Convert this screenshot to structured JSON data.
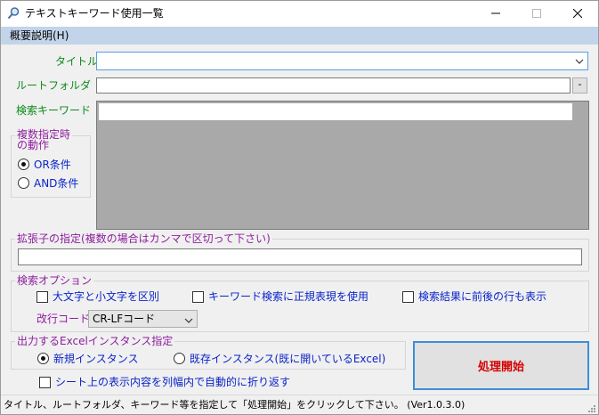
{
  "window": {
    "title": "テキストキーワード使用一覧",
    "icons": {
      "app": "search-icon",
      "minimize": "minimize-icon",
      "maximize": "maximize-icon",
      "close": "close-icon"
    }
  },
  "menu": {
    "overview": "概要説明(H)"
  },
  "form": {
    "title_label": "タイトル",
    "title_value": "",
    "folder_label": "ルートフォルダ",
    "folder_value": "",
    "folder_button": "-",
    "keyword_label": "検索キーワード"
  },
  "multi_group": {
    "caption": "複数指定時\nの動作",
    "options": [
      {
        "label": "OR条件",
        "checked": true
      },
      {
        "label": "AND条件",
        "checked": false
      }
    ]
  },
  "ext_group": {
    "caption": "拡張子の指定(複数の場合はカンマで区切って下さい)",
    "value": ""
  },
  "search_options": {
    "caption": "検索オプション",
    "checks": [
      {
        "label": "大文字と小文字を区別",
        "checked": false
      },
      {
        "label": "キーワード検索に正規表現を使用",
        "checked": false
      },
      {
        "label": "検索結果に前後の行も表示",
        "checked": false
      }
    ],
    "newline_label": "改行コード",
    "newline_value": "CR-LFコード"
  },
  "excel_group": {
    "caption": "出力するExcelインスタンス指定",
    "options": [
      {
        "label": "新規インスタンス",
        "checked": true
      },
      {
        "label": "既存インスタンス(既に開いているExcel)",
        "checked": false
      }
    ]
  },
  "wrap_check": {
    "label": "シート上の表示内容を列幅内で自動的に折り返す",
    "checked": false
  },
  "run_button": "処理開始",
  "status": "タイトル、ルートフォルダ、キーワード等を指定して「処理開始」をクリックして下さい。 (Ver1.0.3.0)",
  "colors": {
    "menubar": "#c2d4e9",
    "label_green": "#0b8a1b",
    "caption_purple": "#8e1e9d",
    "option_blue": "#0a24c8",
    "run_text": "#d40000",
    "keyword_area": "#a9a9a9"
  }
}
